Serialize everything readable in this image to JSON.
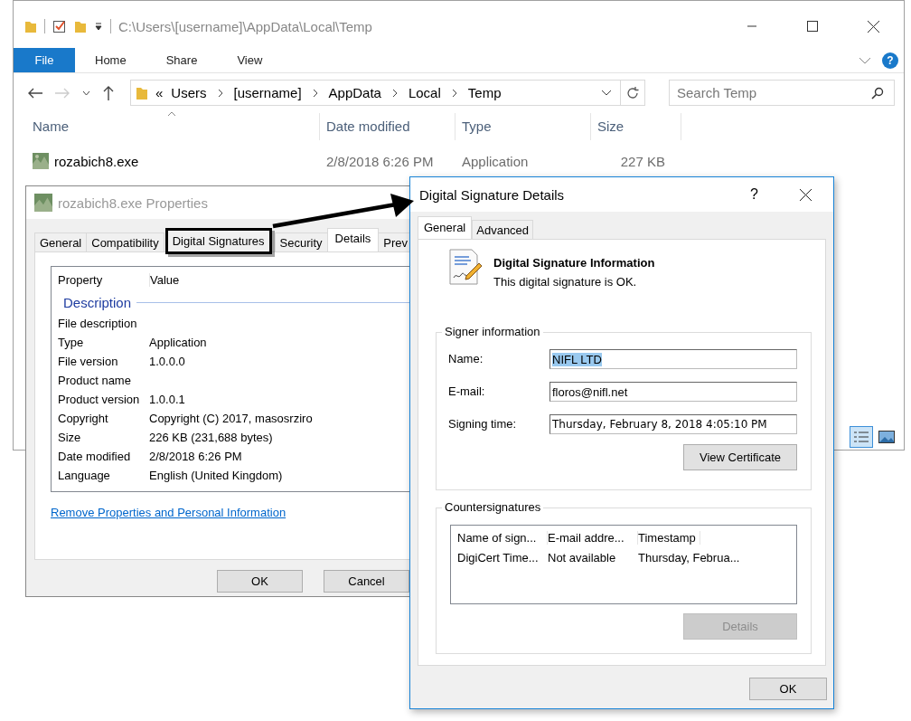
{
  "explorer": {
    "title_path": "C:\\Users\\[username]\\AppData\\Local\\Temp",
    "file_menu": "File",
    "help": "?",
    "ribbon_tabs": [
      "Home",
      "Share",
      "View"
    ],
    "breadcrumb_overflow": "«",
    "breadcrumb": [
      "Users",
      "[username]",
      "AppData",
      "Local",
      "Temp"
    ],
    "search": {
      "placeholder": "Search Temp"
    },
    "columns": [
      "Name",
      "Date modified",
      "Type",
      "Size"
    ],
    "files": [
      {
        "name": "rozabich8.exe",
        "date_modified": "2/8/2018 6:26 PM",
        "type": "Application",
        "size": "227 KB"
      }
    ]
  },
  "properties": {
    "title": "rozabich8.exe Properties",
    "tabs": [
      {
        "label": "General",
        "selected": false,
        "highlighted": false
      },
      {
        "label": "Compatibility",
        "selected": false,
        "highlighted": false
      },
      {
        "label": "Digital Signatures",
        "selected": false,
        "highlighted": true
      },
      {
        "label": "Security",
        "selected": false,
        "highlighted": false
      },
      {
        "label": "Details",
        "selected": true,
        "highlighted": false
      },
      {
        "label": "Prev",
        "selected": false,
        "highlighted": false
      }
    ],
    "columns": [
      "Property",
      "Value"
    ],
    "group": "Description",
    "rows": [
      {
        "property": "File description"
      },
      {
        "property": "Type",
        "value": "Application"
      },
      {
        "property": "File version",
        "value": "1.0.0.0"
      },
      {
        "property": "Product name"
      },
      {
        "property": "Product version",
        "value": "1.0.0.1"
      },
      {
        "property": "Copyright",
        "value": "Copyright (C) 2017, masosrziro"
      },
      {
        "property": "Size",
        "value": "226 KB (231,688 bytes)"
      },
      {
        "property": "Date modified",
        "value": "2/8/2018 6:26 PM"
      },
      {
        "property": "Language",
        "value": "English (United Kingdom)"
      }
    ],
    "link": "Remove Properties and Personal Information",
    "buttons": [
      "OK",
      "Cancel"
    ]
  },
  "dialog": {
    "title": "Digital Signature Details",
    "help": "?",
    "tabs": [
      {
        "label": "General",
        "selected": true
      },
      {
        "label": "Advanced",
        "selected": false
      }
    ],
    "info_title": "Digital Signature Information",
    "info_text": "This digital signature is OK.",
    "signer": {
      "legend": "Signer information",
      "fields": [
        {
          "label": "Name:",
          "value": "NIFL LTD",
          "selected": true
        },
        {
          "label": "E-mail:",
          "value": "floros@nifl.net",
          "selected": false
        },
        {
          "label": "Signing time:",
          "value": "Thursday, February 8, 2018 4:05:10 PM",
          "selected": false
        }
      ],
      "button": "View Certificate"
    },
    "countersignatures": {
      "legend": "Countersignatures",
      "columns": [
        "Name of sign...",
        "E-mail addre...",
        "Timestamp"
      ],
      "rows": [
        [
          "DigiCert Time...",
          "Not available",
          "Thursday, Februa..."
        ]
      ],
      "button": {
        "label": "Details",
        "disabled": true
      }
    },
    "ok": "OK"
  }
}
